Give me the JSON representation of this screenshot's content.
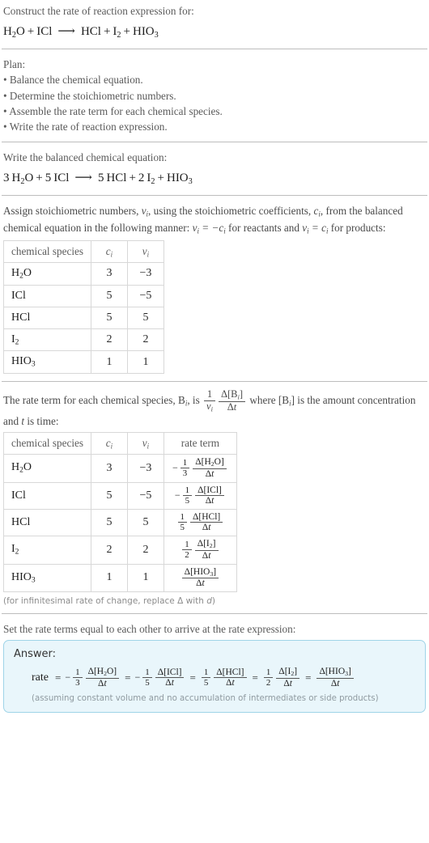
{
  "prompt": {
    "question": "Construct the rate of reaction expression for:",
    "equation": {
      "reactants": [
        {
          "formula": "H2O",
          "coefficient": ""
        },
        {
          "formula": "ICl",
          "coefficient": ""
        }
      ],
      "products": [
        {
          "formula": "HCl",
          "coefficient": ""
        },
        {
          "formula": "I2",
          "coefficient": ""
        },
        {
          "formula": "HIO3",
          "coefficient": ""
        }
      ],
      "arrow": "⟶"
    }
  },
  "plan": {
    "title": "Plan:",
    "steps": [
      "Balance the chemical equation.",
      "Determine the stoichiometric numbers.",
      "Assemble the rate term for each chemical species.",
      "Write the rate of reaction expression."
    ],
    "bullet": "•"
  },
  "balanced": {
    "title": "Write the balanced chemical equation:",
    "equation": {
      "reactants": [
        {
          "coefficient": "3",
          "formula": "H2O"
        },
        {
          "coefficient": "5",
          "formula": "ICl"
        }
      ],
      "products": [
        {
          "coefficient": "5",
          "formula": "HCl"
        },
        {
          "coefficient": "2",
          "formula": "I2"
        },
        {
          "coefficient": "",
          "formula": "HIO3"
        }
      ],
      "arrow": "⟶"
    }
  },
  "stoich": {
    "paragraph_1": "Assign stoichiometric numbers, ",
    "paragraph_2": ", using the stoichiometric coefficients, ",
    "paragraph_3": ", from the balanced chemical equation in the following manner: ",
    "paragraph_4": " for reactants and ",
    "paragraph_5": " for products:",
    "nu_symbol": "ν",
    "c_symbol": "c",
    "sub_i": "i",
    "rule_reactants": "νᵢ = −cᵢ",
    "rule_products": "νᵢ = cᵢ"
  },
  "table1": {
    "headers": {
      "species": "chemical species",
      "c": "c",
      "nu": "ν",
      "sub": "i"
    },
    "rows": [
      {
        "species": "H2O",
        "c": "3",
        "nu": "−3"
      },
      {
        "species": "ICl",
        "c": "5",
        "nu": "−5"
      },
      {
        "species": "HCl",
        "c": "5",
        "nu": "5"
      },
      {
        "species": "I2",
        "c": "2",
        "nu": "2"
      },
      {
        "species": "HIO3",
        "c": "1",
        "nu": "1"
      }
    ]
  },
  "rateterm": {
    "text_1": "The rate term for each chemical species, ",
    "species_symbol": "B",
    "text_2": ", is ",
    "text_3": " where ",
    "amount_bracket": "[Bᵢ]",
    "text_4": " is the amount concentration and ",
    "time_symbol": "t",
    "text_5": " is time:",
    "fraction_outer_num": "1",
    "fraction_outer_den": "νᵢ",
    "fraction_inner_num": "Δ[Bᵢ]",
    "fraction_inner_den": "Δt"
  },
  "table2": {
    "headers": {
      "species": "chemical species",
      "c": "c",
      "nu": "ν",
      "sub": "i",
      "rate": "rate term"
    },
    "rows": [
      {
        "species": "H2O",
        "c": "3",
        "nu": "−3",
        "sign": "−",
        "coef_num": "1",
        "coef_den": "3",
        "delta_num": "Δ[H2O]",
        "delta_den": "Δt"
      },
      {
        "species": "ICl",
        "c": "5",
        "nu": "−5",
        "sign": "−",
        "coef_num": "1",
        "coef_den": "5",
        "delta_num": "Δ[ICl]",
        "delta_den": "Δt"
      },
      {
        "species": "HCl",
        "c": "5",
        "nu": "5",
        "sign": "",
        "coef_num": "1",
        "coef_den": "5",
        "delta_num": "Δ[HCl]",
        "delta_den": "Δt"
      },
      {
        "species": "I2",
        "c": "2",
        "nu": "2",
        "sign": "",
        "coef_num": "1",
        "coef_den": "2",
        "delta_num": "Δ[I2]",
        "delta_den": "Δt"
      },
      {
        "species": "HIO3",
        "c": "1",
        "nu": "1",
        "sign": "",
        "coef_num": "",
        "coef_den": "",
        "delta_num": "Δ[HIO3]",
        "delta_den": "Δt"
      }
    ],
    "footnote": "(for infinitesimal rate of change, replace Δ with d)",
    "footnote_italic_d": "d"
  },
  "final": {
    "lead_in": "Set the rate terms equal to each other to arrive at the rate expression:",
    "answer_label": "Answer:",
    "rate_word": "rate",
    "equals": "=",
    "terms": [
      {
        "sign": "−",
        "coef_num": "1",
        "coef_den": "3",
        "delta_num": "Δ[H2O]",
        "delta_den": "Δt"
      },
      {
        "sign": "−",
        "coef_num": "1",
        "coef_den": "5",
        "delta_num": "Δ[ICl]",
        "delta_den": "Δt"
      },
      {
        "sign": "",
        "coef_num": "1",
        "coef_den": "5",
        "delta_num": "Δ[HCl]",
        "delta_den": "Δt"
      },
      {
        "sign": "",
        "coef_num": "1",
        "coef_den": "2",
        "delta_num": "Δ[I2]",
        "delta_den": "Δt"
      },
      {
        "sign": "",
        "coef_num": "",
        "coef_den": "",
        "delta_num": "Δ[HIO3]",
        "delta_den": "Δt"
      }
    ],
    "assumption": "(assuming constant volume and no accumulation of intermediates or side products)"
  },
  "colors": {
    "answer_bg": "#e9f6fb",
    "answer_border": "#9fd4e8",
    "rule": "#bdbdbd",
    "table_border": "#d8d8d8",
    "label_text": "#5a5a5a",
    "body_text": "#1c1c1c",
    "muted_text": "#8c8c8c"
  }
}
